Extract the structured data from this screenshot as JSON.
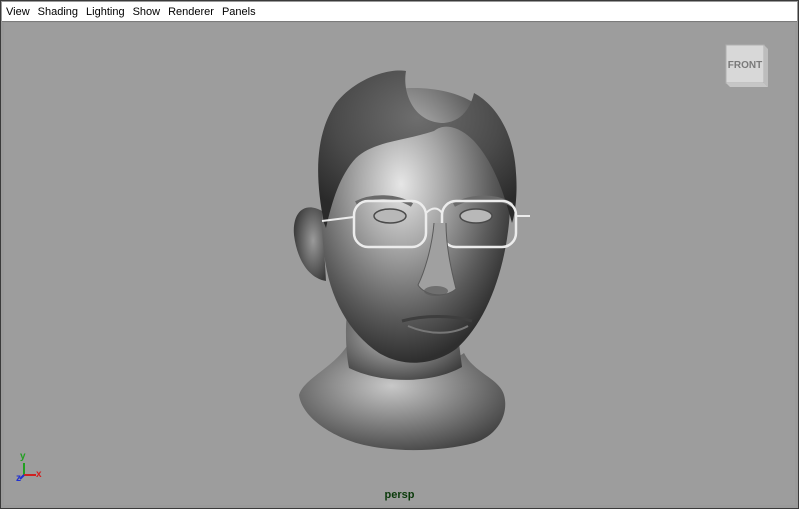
{
  "menubar": {
    "items": [
      "View",
      "Shading",
      "Lighting",
      "Show",
      "Renderer",
      "Panels"
    ]
  },
  "viewport": {
    "camera_label": "persp",
    "viewcube_label": "FRONT",
    "axes": {
      "y": "y",
      "z": "z",
      "x": "x"
    }
  },
  "colors": {
    "background": "#9d9d9d",
    "camera_label": "#0b3a0b",
    "axis_x": "#d02020",
    "axis_y": "#20a020",
    "axis_z": "#2030d0"
  }
}
